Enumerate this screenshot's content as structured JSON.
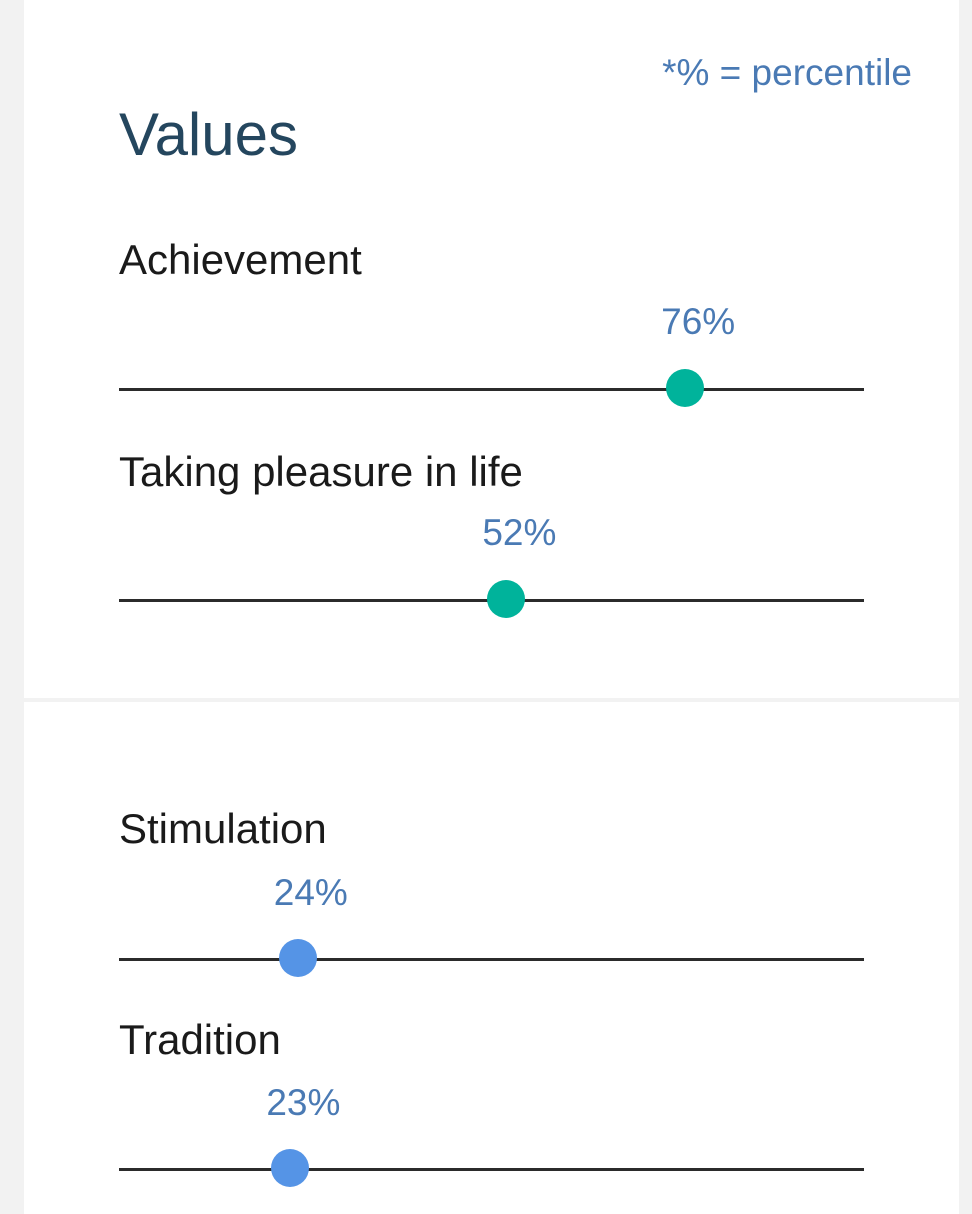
{
  "legend": {
    "note": "*% = percentile"
  },
  "section": {
    "title": "Values"
  },
  "colors": {
    "accent_text": "#4a7ab4",
    "title": "#24465e",
    "teal_thumb": "#00b39b",
    "blue_thumb": "#5594e6"
  },
  "traits": [
    {
      "label": "Achievement",
      "percent_label": "76%",
      "percentile": 0.76,
      "thumb_color": "#00b39b"
    },
    {
      "label": "Taking pleasure in life",
      "percent_label": "52%",
      "percentile": 0.52,
      "thumb_color": "#00b39b"
    },
    {
      "label": "Stimulation",
      "percent_label": "24%",
      "percentile": 0.24,
      "thumb_color": "#5594e6"
    },
    {
      "label": "Tradition",
      "percent_label": "23%",
      "percentile": 0.23,
      "thumb_color": "#5594e6"
    }
  ]
}
